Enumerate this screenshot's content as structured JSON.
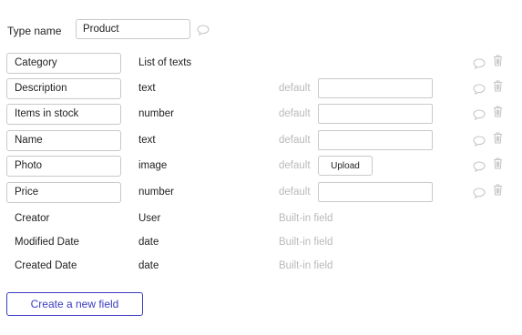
{
  "type_name": {
    "label": "Type name",
    "value": "Product"
  },
  "fields": [
    {
      "name": "Category",
      "type": "List of texts",
      "default_label": "",
      "control": "none"
    },
    {
      "name": "Description",
      "type": "text",
      "default_label": "default",
      "control": "input"
    },
    {
      "name": "Items in stock",
      "type": "number",
      "default_label": "default",
      "control": "input"
    },
    {
      "name": "Name",
      "type": "text",
      "default_label": "default",
      "control": "input"
    },
    {
      "name": "Photo",
      "type": "image",
      "default_label": "default",
      "control": "upload",
      "upload_label": "Upload"
    },
    {
      "name": "Price",
      "type": "number",
      "default_label": "default",
      "control": "input"
    }
  ],
  "builtin_fields": [
    {
      "name": "Creator",
      "type": "User",
      "note": "Built-in field"
    },
    {
      "name": "Modified Date",
      "type": "date",
      "note": "Built-in field"
    },
    {
      "name": "Created Date",
      "type": "date",
      "note": "Built-in field"
    }
  ],
  "create_button_label": "Create a new field",
  "colors": {
    "accent": "#3b3cc2",
    "muted_text": "#b9b9b9",
    "icon": "#c4c4c4",
    "border": "#c9c9c9"
  },
  "icons": {
    "note": "speech-bubble-icon",
    "delete": "trash-icon"
  }
}
